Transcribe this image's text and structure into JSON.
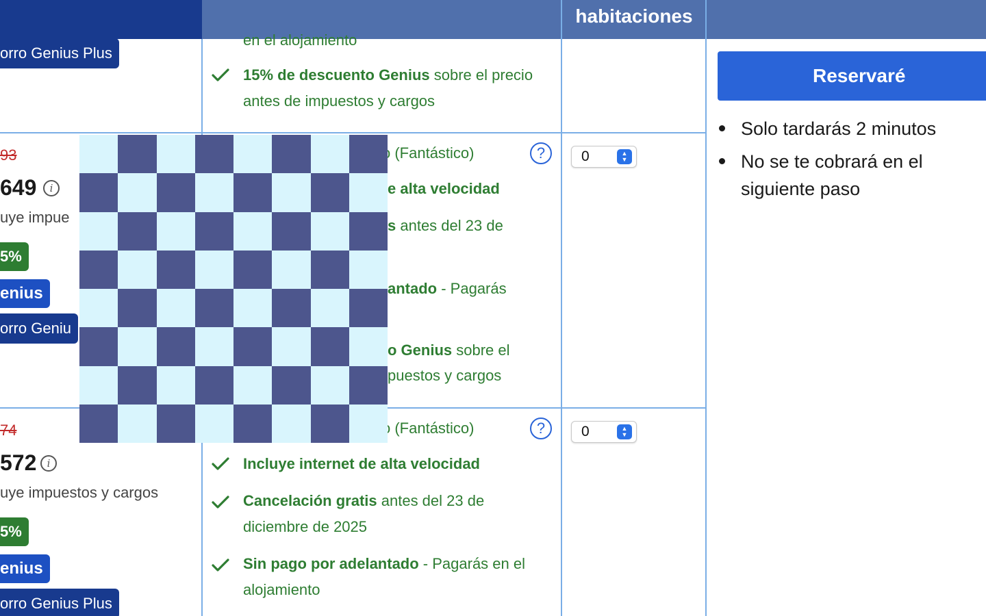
{
  "header": {
    "title": "habitaciones"
  },
  "row_top": {
    "badge_genius_plus": "orro Genius Plus",
    "conditions_partial": "en el alojamiento",
    "genius_discount_bold": "15% de descuento Genius",
    "genius_discount_rest": " sobre el precio antes de impuestos y cargos"
  },
  "row_middle": {
    "old_price": "93",
    "price": "649",
    "taxes": "uye impue",
    "discount_badge": "5%",
    "genius_badge": "enius",
    "genius_plus_badge": "orro Geniu",
    "rating": "o (Fantástico)",
    "internet_bold": "e alta velocidad",
    "cancel_bold": "s",
    "cancel_rest": " antes del 23 de",
    "prepay_bold": "antado",
    "prepay_rest": " - Pagarás",
    "genius_bold": "o Genius",
    "genius_rest": " sobre el",
    "genius_line2": "puestos y cargos",
    "select_value": "0"
  },
  "row_bottom": {
    "old_price": "74",
    "price": "572",
    "taxes": "uye impuestos y cargos",
    "discount_badge": "5%",
    "genius_badge": "enius",
    "genius_plus_badge": "orro Genius Plus",
    "rating": "o (Fantástico)",
    "internet_bold": "Incluye internet de alta velocidad",
    "cancel_bold": "Cancelación gratis",
    "cancel_rest": " antes del 23 de diciembre de 2025",
    "prepay_bold": "Sin pago por adelantado",
    "prepay_rest": " - Pagarás en el alojamiento",
    "select_value": "0"
  },
  "sidebar": {
    "reserve_label": "Reservaré",
    "bullets": [
      "Solo tardarás 2 minutos",
      "No se te cobrará en el siguiente paso"
    ]
  },
  "colors": {
    "header_blue": "#5070ac",
    "navy": "#183a8e",
    "genius_blue": "#1d50c2",
    "green": "#2e7d32",
    "strike_red": "#c22a2a",
    "button_blue": "#2a64d8",
    "board_dark": "#4d568d",
    "board_light": "#d9f5fd"
  },
  "icons": {
    "check": "check-icon",
    "info": "info-icon",
    "help": "question-icon",
    "stepper": "stepper-arrows-icon"
  }
}
